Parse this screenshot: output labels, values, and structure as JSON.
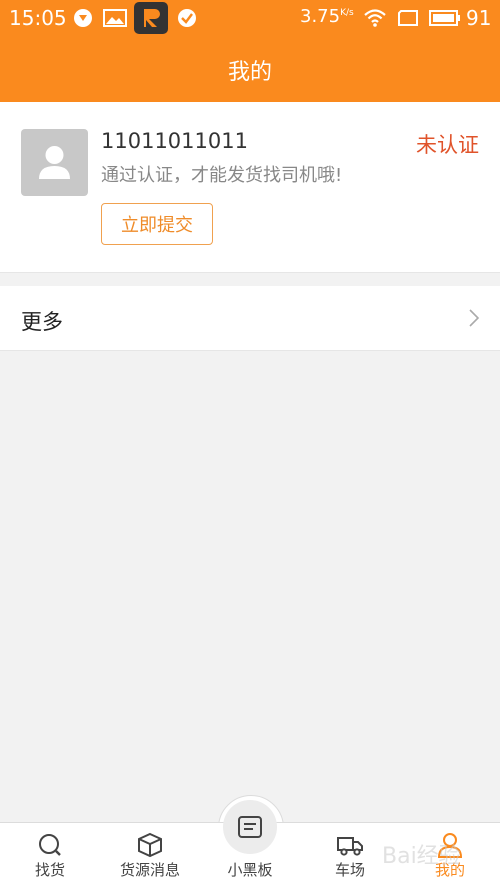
{
  "statusbar": {
    "time": "15:05",
    "speed": "3.75",
    "speed_unit": "K/s",
    "battery": "91"
  },
  "header": {
    "title": "我的"
  },
  "profile": {
    "phone": "11011011011",
    "verify_status": "未认证",
    "hint": "通过认证，才能发货找司机哦!",
    "submit_label": "立即提交"
  },
  "menu": {
    "more_label": "更多"
  },
  "tabs": [
    {
      "label": "找货",
      "icon": "search-icon"
    },
    {
      "label": "货源消息",
      "icon": "box-icon"
    },
    {
      "label": "小黑板",
      "icon": "board-icon"
    },
    {
      "label": "车场",
      "icon": "truck-icon"
    },
    {
      "label": "我的",
      "icon": "user-icon",
      "active": true
    }
  ],
  "watermark": "Bai经验",
  "colors": {
    "accent": "#fa8a1e",
    "status_red": "#e0532a"
  }
}
